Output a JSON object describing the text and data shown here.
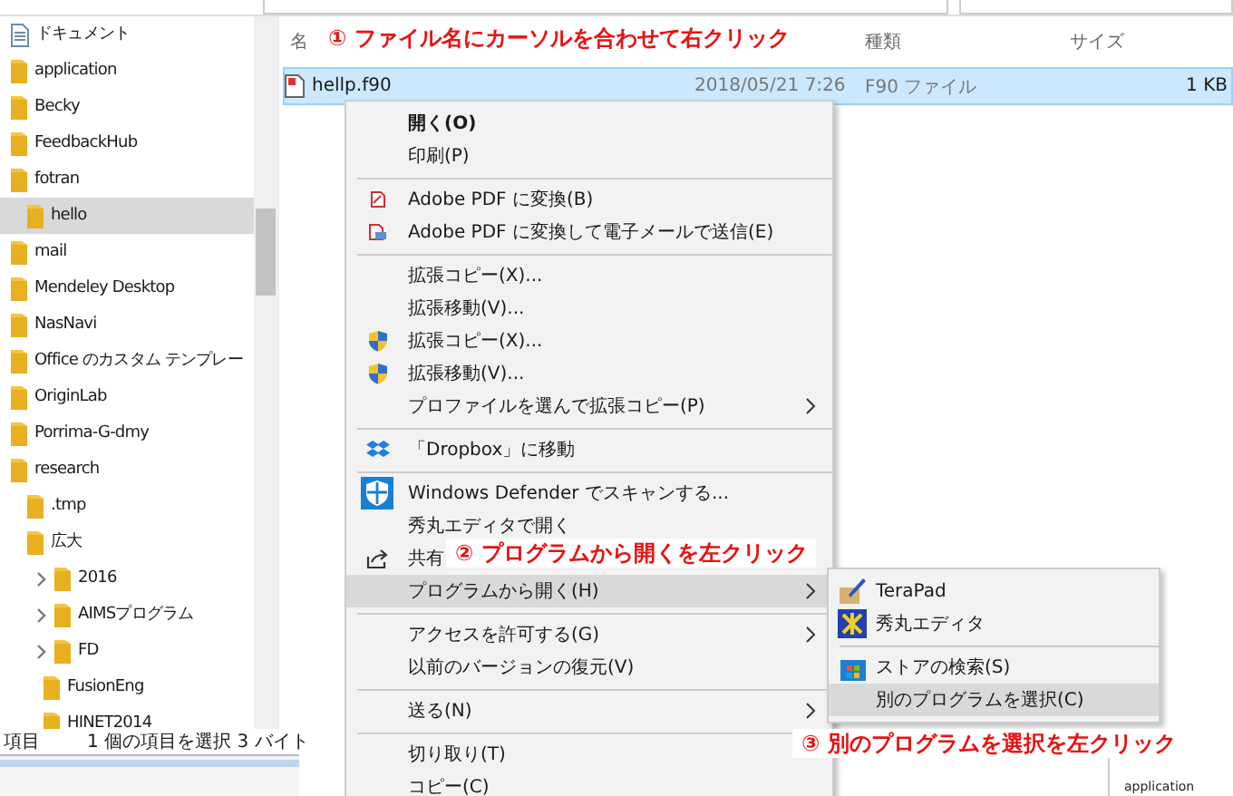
{
  "nav": {
    "items": [
      {
        "label": "ドキュメント",
        "kind": "document",
        "selected": false,
        "expandable": false
      },
      {
        "label": "application",
        "kind": "folder",
        "selected": false,
        "expandable": false
      },
      {
        "label": "Becky",
        "kind": "folder",
        "selected": false,
        "expandable": false
      },
      {
        "label": "FeedbackHub",
        "kind": "folder",
        "selected": false,
        "expandable": false
      },
      {
        "label": "fotran",
        "kind": "folder",
        "selected": false,
        "expandable": false,
        "children": [
          {
            "label": "hello",
            "kind": "folder",
            "selected": true,
            "expandable": false
          }
        ]
      },
      {
        "label": "mail",
        "kind": "folder",
        "selected": false,
        "expandable": false
      },
      {
        "label": "Mendeley Desktop",
        "kind": "folder",
        "selected": false,
        "expandable": false
      },
      {
        "label": "NasNavi",
        "kind": "folder",
        "selected": false,
        "expandable": false
      },
      {
        "label": "Office のカスタム テンプレー",
        "kind": "folder",
        "selected": false,
        "expandable": false
      },
      {
        "label": "OriginLab",
        "kind": "folder",
        "selected": false,
        "expandable": false
      },
      {
        "label": "Porrima-G-dmy",
        "kind": "folder",
        "selected": false,
        "expandable": false
      },
      {
        "label": "research",
        "kind": "folder",
        "selected": false,
        "expandable": false,
        "children": [
          {
            "label": ".tmp",
            "kind": "folder",
            "selected": false,
            "expandable": false
          },
          {
            "label": "広大",
            "kind": "folder",
            "selected": false,
            "expandable": false,
            "children": [
              {
                "label": "2016",
                "kind": "folder",
                "selected": false,
                "expandable": true
              },
              {
                "label": "AIMSプログラム",
                "kind": "folder",
                "selected": false,
                "expandable": true
              },
              {
                "label": "FD",
                "kind": "folder",
                "selected": false,
                "expandable": true
              },
              {
                "label": "FusionEng",
                "kind": "folder",
                "selected": false,
                "expandable": false
              },
              {
                "label": "HINET2014",
                "kind": "folder",
                "selected": false,
                "expandable": false
              }
            ]
          }
        ]
      }
    ]
  },
  "columns": [
    "名",
    "種類",
    "サイズ"
  ],
  "files": [
    {
      "name": "hellp.f90",
      "date": "2018/05/21 7:26",
      "type": "F90 ファイル",
      "size": "1 KB",
      "selected": true
    }
  ],
  "status_bar": {
    "count": "項目",
    "selection": "1 個の項目を選択 3 バイト"
  },
  "corner_item": "application",
  "context_menu": [
    {
      "kind": "plain",
      "label": "開く(O)",
      "bold": true,
      "submenu": false,
      "selected": false
    },
    {
      "kind": "plain",
      "label": "印刷(P)",
      "bold": false,
      "submenu": false,
      "selected": false
    },
    {
      "kind": "separator"
    },
    {
      "kind": "pdf",
      "label": "Adobe PDF に変換(B)",
      "bold": false,
      "submenu": false,
      "selected": false
    },
    {
      "kind": "pdf-mail",
      "label": "Adobe PDF に変換して電子メールで送信(E)",
      "bold": false,
      "submenu": false,
      "selected": false
    },
    {
      "kind": "separator"
    },
    {
      "kind": "plain",
      "label": "拡張コピー(X)...",
      "bold": false,
      "submenu": false,
      "selected": false
    },
    {
      "kind": "plain",
      "label": "拡張移動(V)...",
      "bold": false,
      "submenu": false,
      "selected": false
    },
    {
      "kind": "shield",
      "label": "拡張コピー(X)...",
      "bold": false,
      "submenu": false,
      "selected": false
    },
    {
      "kind": "shield",
      "label": "拡張移動(V)...",
      "bold": false,
      "submenu": false,
      "selected": false
    },
    {
      "kind": "plain",
      "label": "プロファイルを選んで拡張コピー(P)",
      "bold": false,
      "submenu": true,
      "selected": false
    },
    {
      "kind": "separator"
    },
    {
      "kind": "dropbox",
      "label": "「Dropbox」に移動",
      "bold": false,
      "submenu": false,
      "selected": false
    },
    {
      "kind": "separator"
    },
    {
      "kind": "defender",
      "label": "Windows Defender でスキャンする...",
      "bold": false,
      "submenu": false,
      "selected": false
    },
    {
      "kind": "plain",
      "label": "秀丸エディタで開く",
      "bold": false,
      "submenu": false,
      "selected": false
    },
    {
      "kind": "share",
      "label": "共有",
      "bold": false,
      "submenu": false,
      "selected": false
    },
    {
      "kind": "plain",
      "label": "プログラムから開く(H)",
      "bold": false,
      "submenu": true,
      "selected": true
    },
    {
      "kind": "separator"
    },
    {
      "kind": "plain",
      "label": "アクセスを許可する(G)",
      "bold": false,
      "submenu": true,
      "selected": false
    },
    {
      "kind": "plain",
      "label": "以前のバージョンの復元(V)",
      "bold": false,
      "submenu": false,
      "selected": false
    },
    {
      "kind": "separator"
    },
    {
      "kind": "plain",
      "label": "送る(N)",
      "bold": false,
      "submenu": true,
      "selected": false
    },
    {
      "kind": "separator"
    },
    {
      "kind": "plain",
      "label": "切り取り(T)",
      "bold": false,
      "submenu": false,
      "selected": false
    },
    {
      "kind": "plain",
      "label": "コピー(C)",
      "bold": false,
      "submenu": false,
      "selected": false
    }
  ],
  "open_with_menu": [
    {
      "kind": "pen",
      "label": "TeraPad",
      "selected": false
    },
    {
      "kind": "editor",
      "label": "秀丸エディタ",
      "selected": false
    },
    {
      "kind": "separator"
    },
    {
      "kind": "store",
      "label": "ストアの検索(S)",
      "selected": false
    },
    {
      "kind": "plain",
      "label": "別のプログラムを選択(C)",
      "selected": true
    }
  ],
  "annotations": [
    {
      "text": "① ファイル名にカーソルを合わせて右クリック"
    },
    {
      "text": "② プログラムから開くを左クリック"
    },
    {
      "text": "③ 別のプログラムを選択を左クリック"
    }
  ]
}
